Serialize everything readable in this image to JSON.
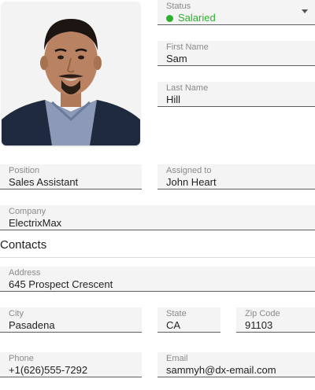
{
  "status": {
    "label": "Status",
    "value": "Salaried",
    "color": "#2bb12b"
  },
  "first_name": {
    "label": "First Name",
    "value": "Sam"
  },
  "last_name": {
    "label": "Last Name",
    "value": "Hill"
  },
  "position": {
    "label": "Position",
    "value": "Sales Assistant"
  },
  "assigned_to": {
    "label": "Assigned to",
    "value": "John Heart"
  },
  "company": {
    "label": "Company",
    "value": "ElectrixMax"
  },
  "contacts_title": "Contacts",
  "address": {
    "label": "Address",
    "value": "645 Prospect Crescent"
  },
  "city": {
    "label": "City",
    "value": "Pasadena"
  },
  "state": {
    "label": "State",
    "value": "CA"
  },
  "zip": {
    "label": "Zip Code",
    "value": "91103"
  },
  "phone": {
    "label": "Phone",
    "value": "+1(626)555-7292"
  },
  "email": {
    "label": "Email",
    "value": "sammyh@dx-email.com"
  }
}
